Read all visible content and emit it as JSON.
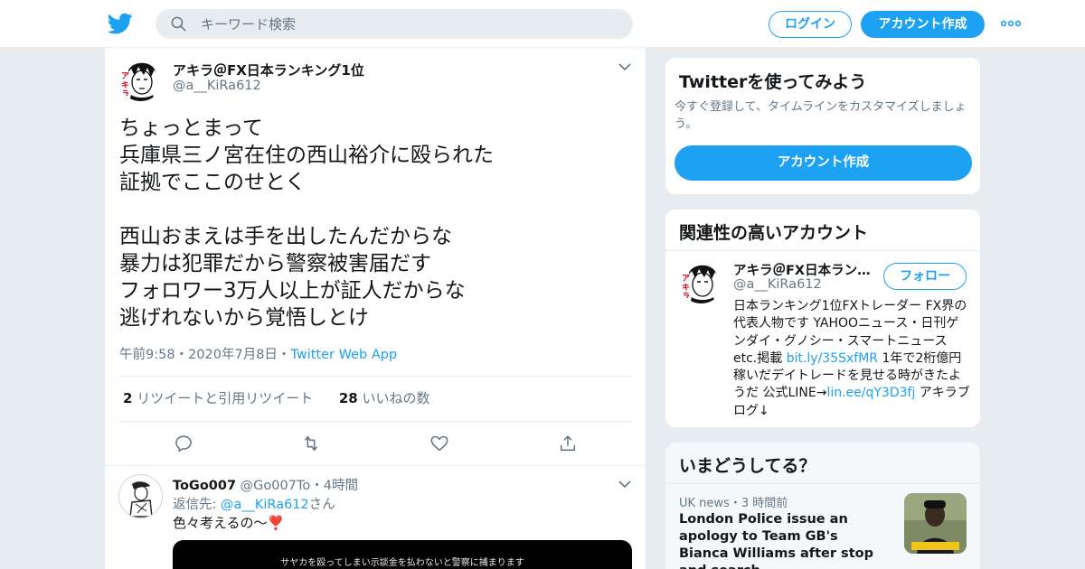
{
  "header": {
    "search_placeholder": "キーワード検索",
    "login_label": "ログイン",
    "signup_label": "アカウント作成",
    "brand_color": "#1da1f2"
  },
  "tweet": {
    "author_name": "アキラ＠FX日本ランキング1位",
    "author_handle": "@a__KiRa612",
    "text": "ちょっとまって\n兵庫県三ノ宮在住の西山裕介に殴られた\n証拠でここのせとく\n\n西山おまえは手を出したんだからな\n暴力は犯罪だから警察被害届だす\nフォロワー3万人以上が証人だからな\n逃げれないから覚悟しとけ",
    "time": "午前9:58",
    "date": "2020年7月8日",
    "via": "Twitter Web App",
    "retweet_count": "2",
    "retweet_label": "リツイートと引用リツイート",
    "like_count": "28",
    "like_label": "いいねの数"
  },
  "reply": {
    "name": "ToGo007",
    "handle": "@Go007To",
    "time": "4時間",
    "replying_prefix": "返信先:",
    "replying_handle": "@a__KiRa612",
    "replying_suffix": "さん",
    "text": "色々考えるの〜",
    "emoji": "❣️",
    "media_caption": "サヤカを殴ってしまい示談金を払わないと警察に捕まります"
  },
  "sidebar": {
    "try": {
      "title": "Twitterを使ってみよう",
      "desc": "今すぐ登録して、タイムラインをカスタマイズしましょう。",
      "button": "アカウント作成"
    },
    "related": {
      "title": "関連性の高いアカウント",
      "name": "アキラ＠FX日本ランキング1位",
      "handle": "@a__KiRa612",
      "follow": "フォロー",
      "bio_1": "日本ランキング1位FXトレーダー FX界の代表人物です YAHOOニュース・日刊ゲンダイ・グノシー・スマートニュースetc.掲載 ",
      "bio_link1": "bit.ly/35SxfMR",
      "bio_2": " 1年で2桁億円稼いだデイトレードを見せる時がきたようだ 公式LINE→",
      "bio_link2": "lin.ee/qY3D3fj",
      "bio_3": " アキラブログ↓"
    },
    "trends": {
      "title": "いまどうしてる？",
      "meta": "UK news・3 時間前",
      "headline": "London Police issue an apology to Team GB's Bianca Williams after stop and search"
    }
  }
}
